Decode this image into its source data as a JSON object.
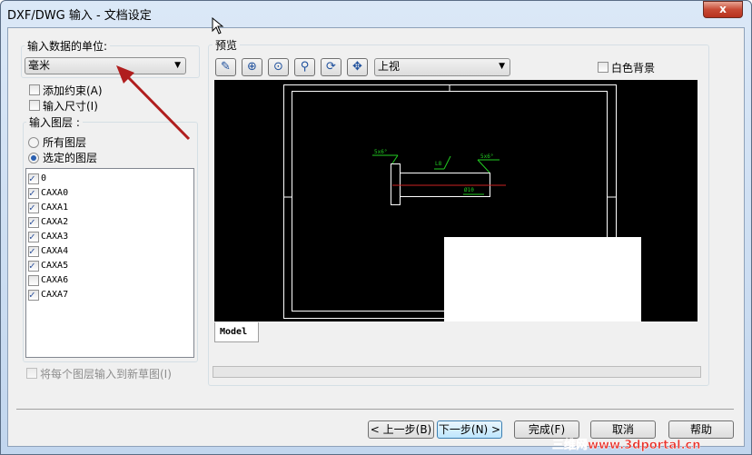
{
  "window": {
    "title": "DXF/DWG 输入 - 文档设定",
    "close_label": "x"
  },
  "units": {
    "group_label": "输入数据的单位:",
    "selected": "毫米"
  },
  "options": {
    "add_constraints": {
      "label": "添加约束(A)",
      "checked": false
    },
    "import_dimensions": {
      "label": "输入尺寸(I)",
      "checked": false
    }
  },
  "layers": {
    "group_label": "输入图层 :",
    "all_layers": "所有图层",
    "selected_layers": "选定的图层",
    "selected_mode": "selected",
    "items": [
      {
        "name": "0",
        "checked": true
      },
      {
        "name": "CAXA0",
        "checked": true
      },
      {
        "name": "CAXA1",
        "checked": true
      },
      {
        "name": "CAXA2",
        "checked": true
      },
      {
        "name": "CAXA3",
        "checked": true
      },
      {
        "name": "CAXA4",
        "checked": true
      },
      {
        "name": "CAXA5",
        "checked": true
      },
      {
        "name": "CAXA6",
        "checked": false
      },
      {
        "name": "CAXA7",
        "checked": true
      }
    ]
  },
  "each_layer_new_sketch": {
    "label": "将每个图层输入到新草图(I)",
    "checked": false,
    "disabled": true
  },
  "preview": {
    "group_label": "预览",
    "view_selected": "上视",
    "white_background": {
      "label": "白色背景",
      "checked": false
    },
    "toolbar": [
      "select-icon",
      "zoom-fit-icon",
      "zoom-area-icon",
      "zoom-in-out-icon",
      "rotate-icon",
      "pan-icon"
    ],
    "tab": "Model",
    "drawing_labels": {
      "a": "5x6°",
      "b": "L8",
      "c": "5x6°",
      "d": "Ø10"
    }
  },
  "buttons": {
    "back": "< 上一步(B)",
    "next": "下一步(N) >",
    "finish": "完成(F)",
    "cancel": "取消",
    "help": "帮助"
  },
  "watermark": "三维网www.3dportal.cn",
  "colors": {
    "canvas": "#000000",
    "drawing": "#ffffff",
    "dims": "#22cc22",
    "centerline": "#cc2222",
    "arrow": "#b01e1e"
  }
}
